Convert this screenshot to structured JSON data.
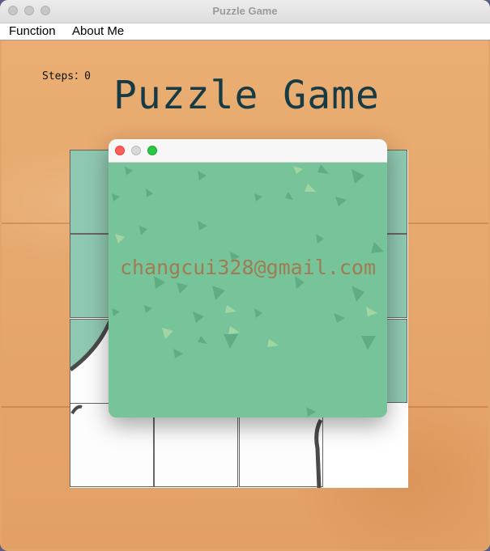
{
  "window": {
    "title": "Puzzle Game"
  },
  "menu": {
    "items": [
      "Function",
      "About Me"
    ]
  },
  "game": {
    "steps_label": "Steps：",
    "steps_value": "0",
    "title": "Puzzle Game"
  },
  "about_popup": {
    "email": "changcui328@gmail.com"
  },
  "colors": {
    "wood": "#e3a66a",
    "title_text": "#173b44",
    "popup_green": "#78c49a",
    "email_text": "#a07c52",
    "close": "#fe5f57",
    "minimize": "#d9d9d9",
    "zoom": "#28c840"
  },
  "board": {
    "tile_ids": [
      "tile-1",
      "tile-2",
      "tile-3",
      "tile-4",
      "tile-5",
      "tile-6",
      "tile-7",
      "tile-8",
      "tile-9",
      "tile-10",
      "tile-11",
      "tile-12",
      "tile-13",
      "tile-14",
      "tile-15",
      "tile-empty"
    ]
  }
}
